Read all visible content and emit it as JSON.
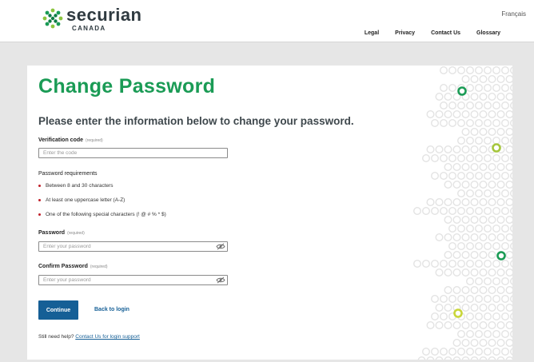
{
  "header": {
    "brand": "securian",
    "brand_sub": "CANADA",
    "language_link": "Français",
    "nav": [
      "Legal",
      "Privacy",
      "Contact Us",
      "Glossary"
    ]
  },
  "form": {
    "title": "Change Password",
    "subtitle": "Please enter the information below to change your password.",
    "required_tag": "(required)",
    "verification": {
      "label": "Verification code",
      "placeholder": "Enter the code",
      "value": ""
    },
    "requirements_heading": "Password requirements",
    "requirements": [
      "Between 8 and 30 characters",
      "At least one uppercase letter (A-Z)",
      "One of the following special characters (! @ # % * $)"
    ],
    "password": {
      "label": "Password",
      "placeholder": "Enter your password",
      "value": "",
      "toggle_icon": "eye-slash-icon"
    },
    "confirm_password": {
      "label": "Confirm Password",
      "placeholder": "Enter your password",
      "value": "",
      "toggle_icon": "eye-slash-icon"
    },
    "continue_label": "Continue",
    "back_label": "Back to login",
    "help_prefix": "Still need help?",
    "help_link": "Contact Us for login support"
  },
  "colors": {
    "brand_green": "#1a9b55",
    "link_blue": "#155f96",
    "bullet_red": "#c0212b",
    "accent_lime": "#a5c63b"
  }
}
